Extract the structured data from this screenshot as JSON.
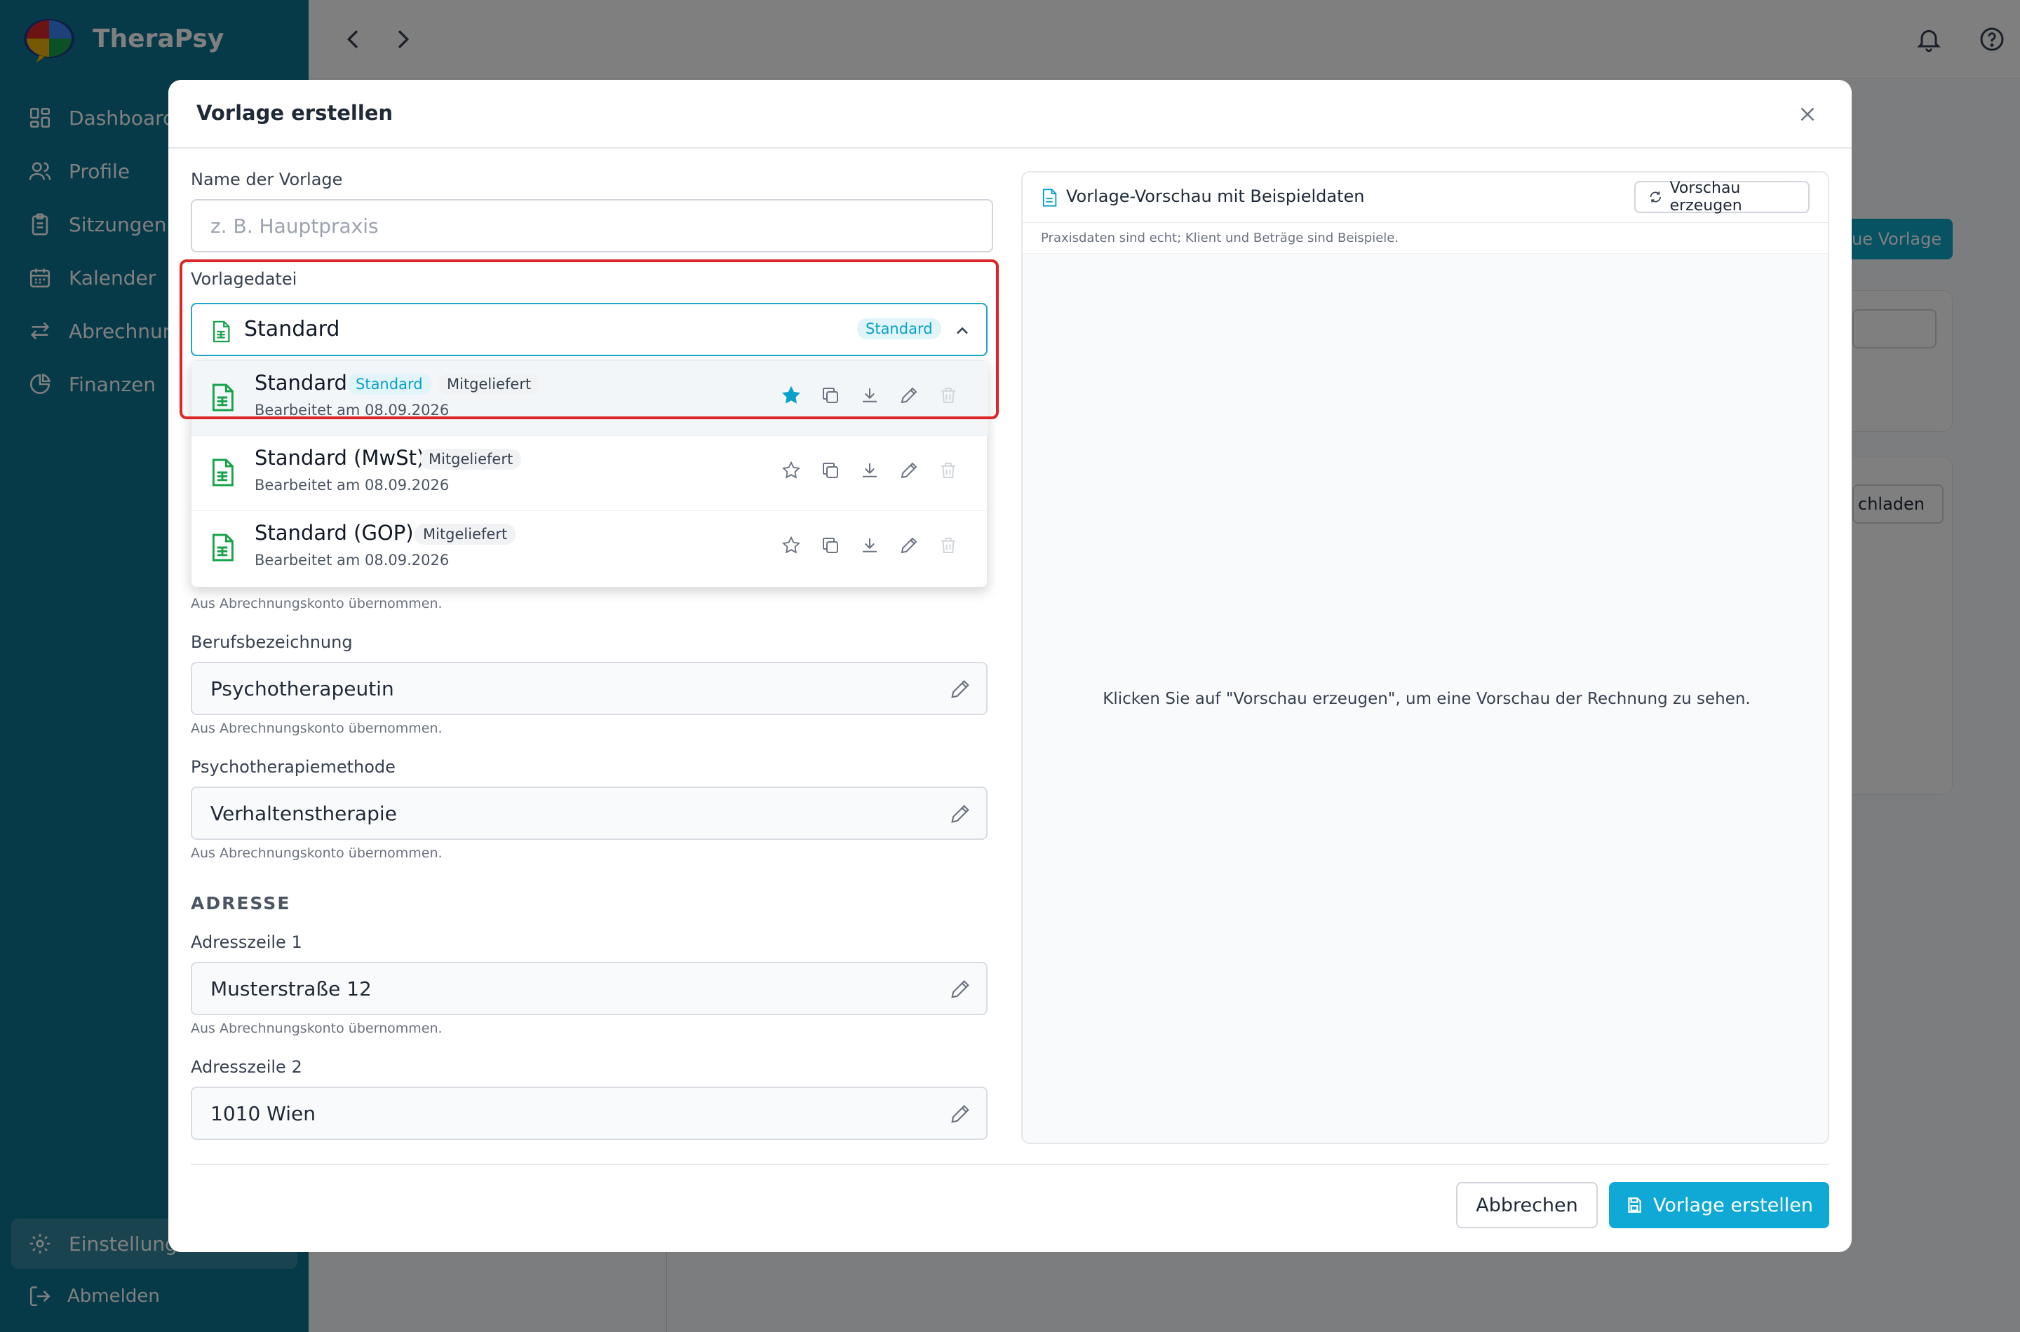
{
  "app": {
    "name": "TheraPsy"
  },
  "sidebar": {
    "items": [
      {
        "label": "Dashboard",
        "icon": "dashboard-icon"
      },
      {
        "label": "Profile",
        "icon": "users-icon"
      },
      {
        "label": "Sitzungen",
        "icon": "clipboard-icon"
      },
      {
        "label": "Kalender",
        "icon": "calendar-icon"
      },
      {
        "label": "Abrechnung",
        "icon": "arrows-icon"
      },
      {
        "label": "Finanzen",
        "icon": "pie-chart-icon"
      }
    ],
    "settings": "Einstellung",
    "logout": "Abmelden"
  },
  "background": {
    "new_template_button": "ue Vorlage",
    "download_button": "chladen"
  },
  "modal": {
    "title": "Vorlage erstellen",
    "name_label": "Name der Vorlage",
    "name_placeholder": "z. B. Hauptpraxis",
    "file_label": "Vorlagedatei",
    "selected": {
      "name": "Standard",
      "tag": "Standard"
    },
    "options": [
      {
        "name": "Standard",
        "tag_std": "Standard",
        "tag_mit": "Mitgeliefert",
        "date": "Bearbeitet am 08.09.2026",
        "starred": true
      },
      {
        "name": "Standard (MwSt)",
        "tag_mit": "Mitgeliefert",
        "date": "Bearbeitet am 08.09.2026",
        "starred": false
      },
      {
        "name": "Standard (GOP)",
        "tag_mit": "Mitgeliefert",
        "date": "Bearbeitet am 08.09.2026",
        "starred": false
      }
    ],
    "hint": "Aus Abrechnungskonto übernommen.",
    "job_label": "Berufsbezeichnung",
    "job_value": "Psychotherapeutin",
    "method_label": "Psychotherapiemethode",
    "method_value": "Verhaltenstherapie",
    "address_section": "ADRESSE",
    "addr1_label": "Adresszeile 1",
    "addr1_value": "Musterstraße 12",
    "addr2_label": "Adresszeile 2",
    "addr2_value": "1010 Wien",
    "preview": {
      "title": "Vorlage-Vorschau mit Beispieldaten",
      "button": "Vorschau erzeugen",
      "subtitle": "Praxisdaten sind echt; Klient und Beträge sind Beispiele.",
      "empty": "Klicken Sie auf \"Vorschau erzeugen\", um eine Vorschau der Rechnung zu sehen."
    },
    "cancel": "Abbrechen",
    "submit": "Vorlage erstellen"
  },
  "colors": {
    "sidebar": "#0e7490",
    "accent": "#10a8d4",
    "highlight": "#dc2626"
  }
}
